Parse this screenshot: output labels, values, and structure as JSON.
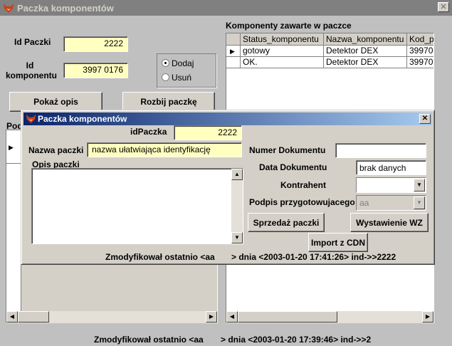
{
  "main": {
    "title": "Paczka komponentów",
    "close_glyph": "✕",
    "id_paczki_label": "Id Paczki",
    "id_paczki_value": "2222",
    "id_komponentu_label": "Id komponentu",
    "id_komponentu_value": "3997 0176",
    "radio_add_label": "Dodaj",
    "radio_remove_label": "Usuń",
    "show_desc_button": "Pokaż opis",
    "split_button": "Rozbij paczkę",
    "left_section_label_fragment": "Pod",
    "components_title": "Komponenty zawarte w paczce",
    "components_grid": {
      "columns": [
        "Status_komponentu",
        "Nazwa_komponentu",
        "Kod_p"
      ],
      "rows": [
        [
          "gotowy",
          "Detektor DEX",
          "39970"
        ],
        [
          "OK.",
          "Detektor DEX",
          "39970"
        ]
      ]
    },
    "status_left": "Zmodyfikował ostatnio <aa",
    "status_right": "> dnia <2003-01-20 17:39:46> ind->>2"
  },
  "dialog": {
    "title": "Paczka komponentów",
    "close_glyph": "✕",
    "id_label": "idPaczka",
    "id_value": "2222",
    "name_label": "Nazwa paczki",
    "name_value": "nazwa ułatwiająca identyfikację",
    "desc_label": "Opis paczki",
    "desc_value": "",
    "doc_number_label": "Numer Dokumentu",
    "doc_number_value": "",
    "doc_date_label": "Data Dokumentu",
    "doc_date_value": "brak danych",
    "contractor_label": "Kontrahent",
    "contractor_value": "",
    "preparer_label": "Podpis przygotowujacego",
    "preparer_value": "aa",
    "sale_button": "Sprzedaż paczki",
    "wz_button": "Wystawienie WZ",
    "import_button": "Import z CDN",
    "status_left": "Zmodyfikował ostatnio <aa",
    "status_right": "> dnia <2003-01-20 17:41:26> ind->>2222"
  }
}
